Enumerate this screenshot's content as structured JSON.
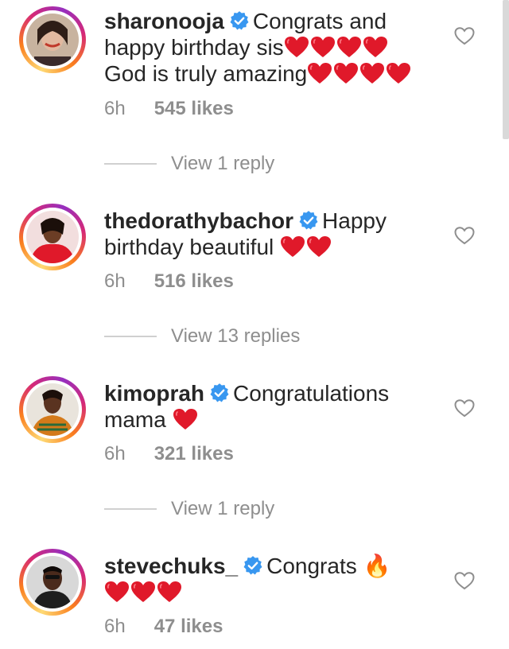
{
  "comments": [
    {
      "username": "sharonooja",
      "text_line1": "Congrats and",
      "text_line2": "happy birthday sis",
      "text_line3": "God is truly amazing",
      "time": "6h",
      "likes": "545 likes",
      "replies": "View 1 reply"
    },
    {
      "username": "thedorathybachor",
      "text_line1": "Happy",
      "text_line2": "birthday beautiful",
      "time": "6h",
      "likes": "516 likes",
      "replies": "View 13 replies"
    },
    {
      "username": "kimoprah",
      "text_line1": "Congratulations",
      "text_line2": "mama",
      "time": "6h",
      "likes": "321 likes",
      "replies": "View 1 reply"
    },
    {
      "username": "stevechuks_",
      "text_line1": "Congrats 🔥",
      "time": "6h",
      "likes": "47 likes"
    }
  ],
  "colors": {
    "heart": "#e0192a",
    "verified": "#3897f0",
    "muted": "#8e8e8e",
    "text": "#262626"
  },
  "icons": [
    "verified-badge-icon",
    "red-heart-emoji",
    "like-heart-outline-icon",
    "fire-emoji"
  ]
}
